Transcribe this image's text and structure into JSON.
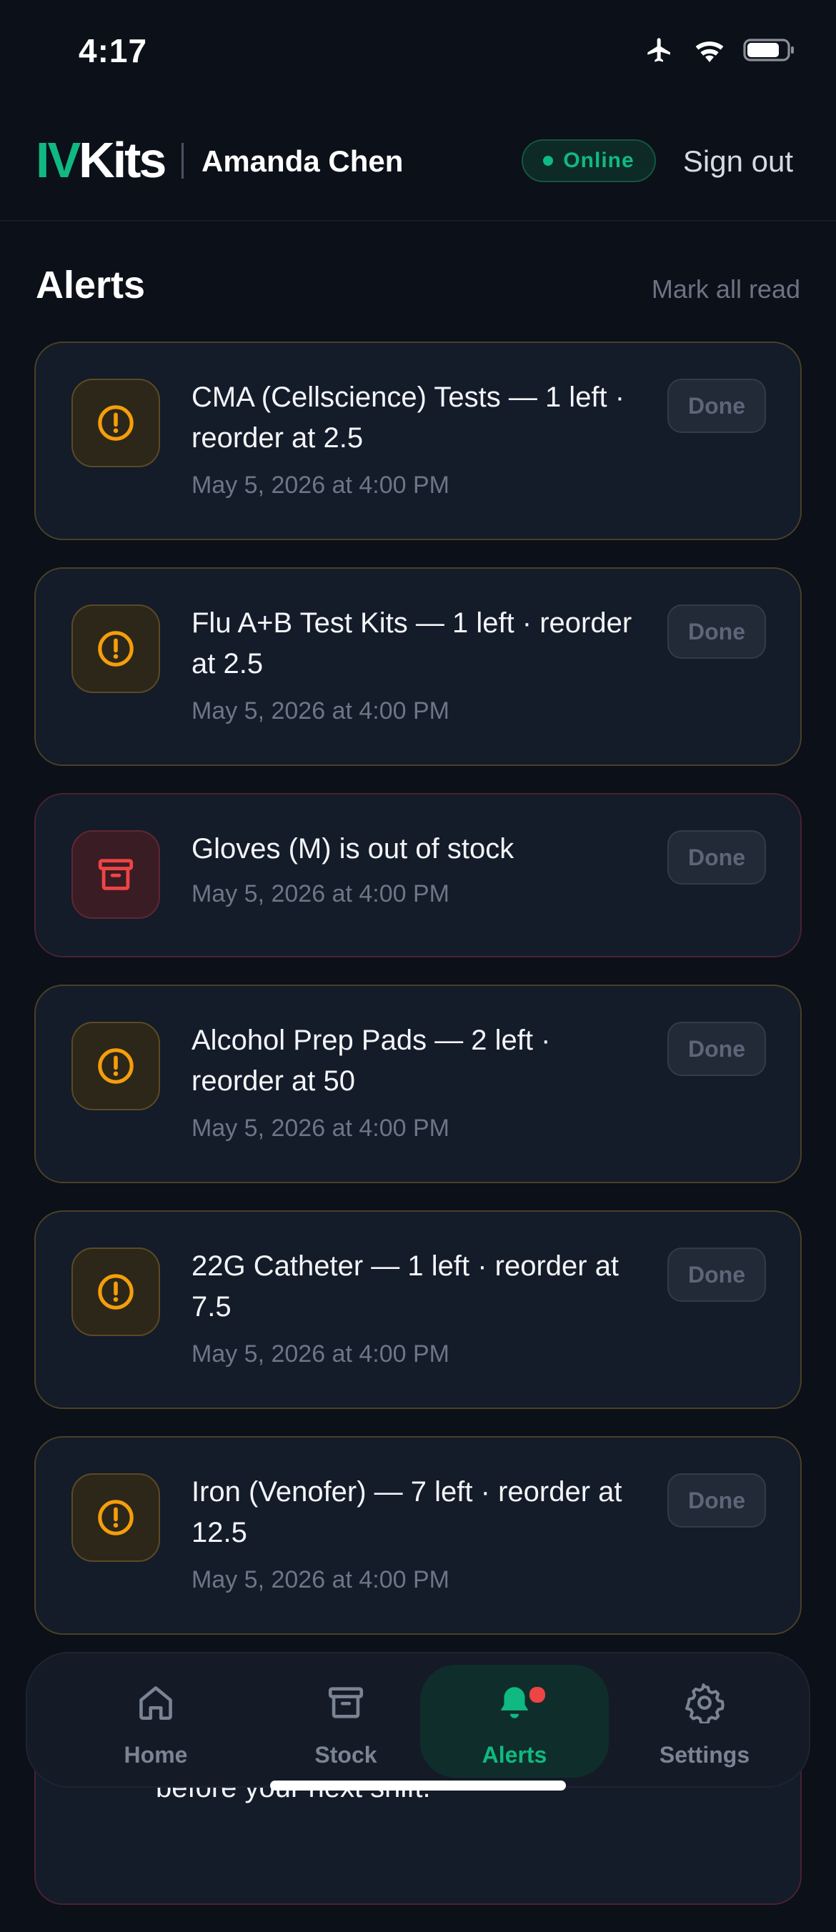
{
  "status_bar": {
    "time": "4:17"
  },
  "header": {
    "logo_iv": "IV",
    "logo_kits": "Kits",
    "user_name": "Amanda Chen",
    "status_label": "Online",
    "sign_out": "Sign out"
  },
  "alerts_section": {
    "title": "Alerts",
    "mark_all_read": "Mark all read",
    "done_label": "Done",
    "items": [
      {
        "severity": "warning",
        "icon": "alert-circle-icon",
        "text": "CMA (Cellscience) Tests — 1 left · reorder at 2.5",
        "time": "May 5, 2026 at 4:00 PM"
      },
      {
        "severity": "warning",
        "icon": "alert-circle-icon",
        "text": "Flu A+B Test Kits — 1 left · reorder at 2.5",
        "time": "May 5, 2026 at 4:00 PM"
      },
      {
        "severity": "danger",
        "icon": "archive-box-icon",
        "text": "Gloves (M) is out of stock",
        "time": "May 5, 2026 at 4:00 PM"
      },
      {
        "severity": "warning",
        "icon": "alert-circle-icon",
        "text": "Alcohol Prep Pads — 2 left · reorder at 50",
        "time": "May 5, 2026 at 4:00 PM"
      },
      {
        "severity": "warning",
        "icon": "alert-circle-icon",
        "text": "22G Catheter — 1 left · reorder at 7.5",
        "time": "May 5, 2026 at 4:00 PM"
      },
      {
        "severity": "warning",
        "icon": "alert-circle-icon",
        "text": "Iron (Venofer) — 7 left · reorder at 12.5",
        "time": "May 5, 2026 at 4:00 PM"
      }
    ],
    "partial_item_text": "before your next shift."
  },
  "tab_bar": {
    "tabs": [
      {
        "label": "Home",
        "icon": "home-icon",
        "active": false
      },
      {
        "label": "Stock",
        "icon": "archive-box-icon",
        "active": false
      },
      {
        "label": "Alerts",
        "icon": "bell-icon",
        "active": true,
        "has_badge": true
      },
      {
        "label": "Settings",
        "icon": "gear-icon",
        "active": false
      }
    ]
  },
  "colors": {
    "accent": "#10b981",
    "warning": "#f59e0b",
    "danger": "#ef4444",
    "background": "#0b1019",
    "card": "#141b29"
  }
}
